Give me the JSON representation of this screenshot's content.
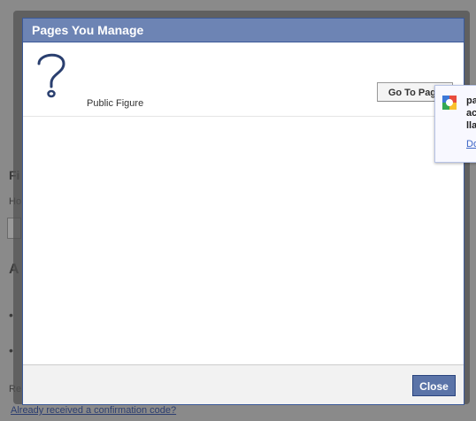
{
  "dialog": {
    "title": "Pages You Manage",
    "pages": [
      {
        "name": "Public Figure",
        "avatar_icon": "question-mark-icon",
        "button_label": "Go To Page"
      }
    ],
    "close_label": "Close"
  },
  "background": {
    "frag1": "Fi",
    "frag2": "Ho",
    "frag3": "A",
    "frag4": "•",
    "frag5": "•",
    "frag6": "Re",
    "frag7": "Already received a confirmation code?"
  },
  "popup": {
    "line1": "pa",
    "line2": "ac",
    "line3": "lla",
    "link": "Do",
    "icon": "google-icon"
  },
  "colors": {
    "header": "#6d84b4",
    "header_border": "#3b5998",
    "close_button": "#5b74a8"
  }
}
